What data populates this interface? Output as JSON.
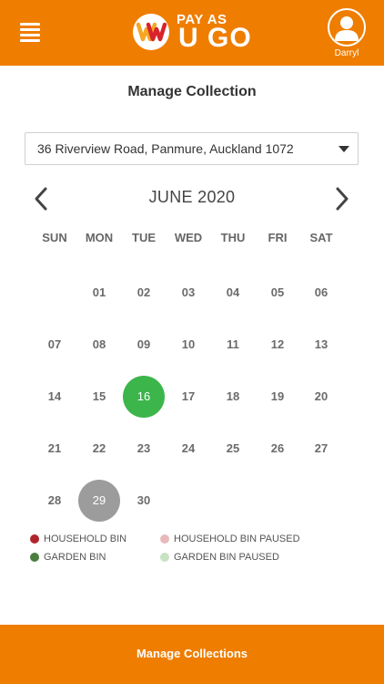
{
  "header": {
    "logo_top": "PAY AS",
    "logo_bottom": "U GO",
    "user_name": "Darryl",
    "color": "#ef7d00"
  },
  "page_title": "Manage Collection",
  "address": {
    "selected": "36 Riverview Road, Panmure, Auckland 1072"
  },
  "calendar": {
    "month_label": "JUNE 2020",
    "weekdays": [
      "SUN",
      "MON",
      "TUE",
      "WED",
      "THU",
      "FRI",
      "SAT"
    ],
    "weeks": [
      [
        "",
        "01",
        "02",
        "03",
        "04",
        "05",
        "06"
      ],
      [
        "07",
        "08",
        "09",
        "10",
        "11",
        "12",
        "13"
      ],
      [
        "14",
        "15",
        "16",
        "17",
        "18",
        "19",
        "20"
      ],
      [
        "21",
        "22",
        "23",
        "24",
        "25",
        "26",
        "27"
      ],
      [
        "28",
        "29",
        "30",
        "",
        "",
        "",
        ""
      ]
    ],
    "highlighted": [
      {
        "day": "16",
        "color": "#3cb54a"
      },
      {
        "day": "29",
        "color": "#9c9c9c"
      }
    ]
  },
  "legend": [
    {
      "label": "HOUSEHOLD BIN",
      "color": "#b0252b"
    },
    {
      "label": "HOUSEHOLD BIN PAUSED",
      "color": "#e8b9bb"
    },
    {
      "label": "GARDEN BIN",
      "color": "#4a7f3f"
    },
    {
      "label": "GARDEN BIN PAUSED",
      "color": "#c8e2c4"
    }
  ],
  "footer": {
    "button_label": "Manage Collections"
  },
  "icons": {
    "menu": "menu-icon",
    "avatar": "user-icon",
    "prev": "chevron-left-icon",
    "next": "chevron-right-icon",
    "dropdown": "caret-down-icon"
  }
}
